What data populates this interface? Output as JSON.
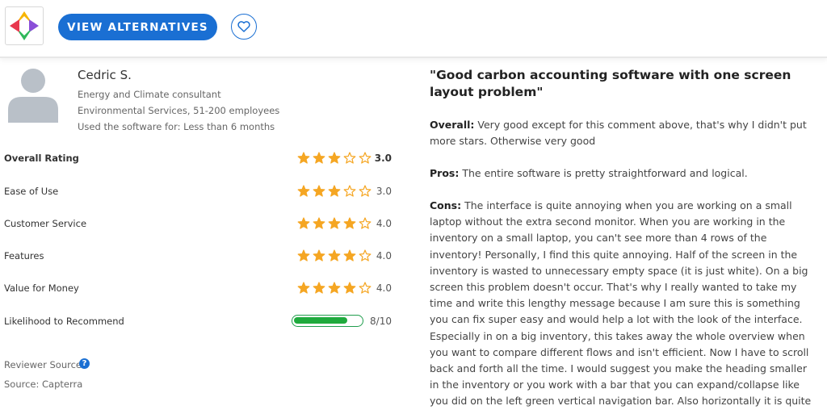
{
  "header": {
    "view_button_label": "VIEW ALTERNATIVES"
  },
  "reviewer": {
    "name": "Cedric S.",
    "role": "Energy and Climate consultant",
    "industry": "Environmental Services, 51-200 employees",
    "usage": "Used the software for: Less than 6 months"
  },
  "ratings": [
    {
      "label": "Overall Rating",
      "value": "3.0",
      "stars": 3
    },
    {
      "label": "Ease of Use",
      "value": "3.0",
      "stars": 3
    },
    {
      "label": "Customer Service",
      "value": "4.0",
      "stars": 4
    },
    {
      "label": "Features",
      "value": "4.0",
      "stars": 4
    },
    {
      "label": "Value for Money",
      "value": "4.0",
      "stars": 4
    }
  ],
  "recommend": {
    "label": "Likelihood to Recommend",
    "value": "8/10",
    "fraction": 0.8
  },
  "source": {
    "label": "Reviewer Source",
    "value": "Source: Capterra"
  },
  "review": {
    "title": "\"Good carbon accounting software with one screen layout problem\"",
    "overall_label": "Overall:",
    "overall_text": "Very good except for this comment above, that's why I didn't put more stars. Otherwise very good",
    "pros_label": "Pros:",
    "pros_text": "The entire software is pretty straightforward and logical.",
    "cons_label": "Cons:",
    "cons_text": "The interface is quite annoying when you are working on a small laptop without the extra second monitor. When you are working in the inventory on a small laptop, you can't see more than 4 rows of the inventory! Personally, I find this quite annoying. Half of the screen in the inventory is wasted to unnecessary empty space (it is just white). On a big screen this problem doesn't occur. That's why I really wanted to take my time and write this lengthy message because I am sure this is something you can fix super easy and would help a lot with the look of the interface. Especially in on a big inventory, this takes away the whole overview when you want to compare different flows and isn't efficient. Now I have to scroll back and forth all the time. I would suggest you make the heading smaller in the inventory or you work with a bar that you can expand/collapse like you did on the left green vertical navigation bar. Also horizontally it is quite"
  },
  "colors": {
    "accent_blue": "#1a6fd3",
    "star_orange": "#f5a623",
    "progress_green": "#1faa3d"
  }
}
